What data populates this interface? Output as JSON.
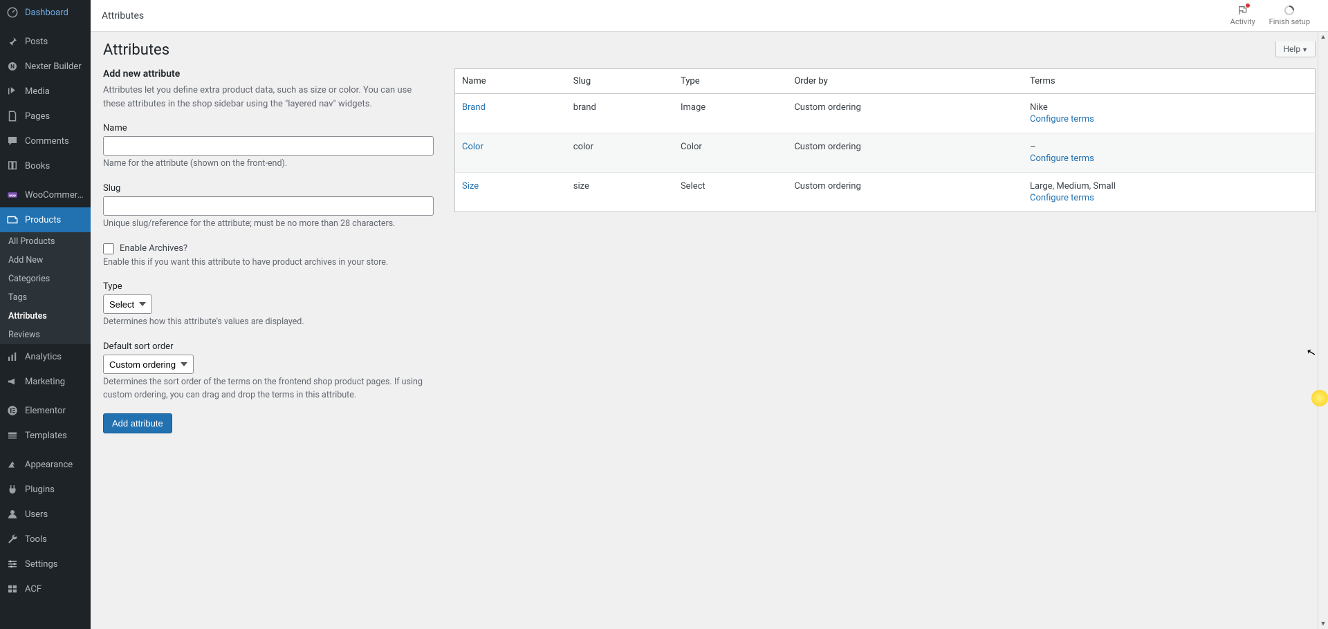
{
  "sidebar": {
    "items": [
      {
        "icon": "dashboard",
        "label": "Dashboard"
      },
      {
        "icon": "pin",
        "label": "Posts"
      },
      {
        "icon": "nexter",
        "label": "Nexter Builder"
      },
      {
        "icon": "media",
        "label": "Media"
      },
      {
        "icon": "page",
        "label": "Pages"
      },
      {
        "icon": "comments",
        "label": "Comments"
      },
      {
        "icon": "book",
        "label": "Books"
      },
      {
        "icon": "woo",
        "label": "WooCommerce"
      },
      {
        "icon": "products",
        "label": "Products",
        "current": true
      },
      {
        "icon": "analytics",
        "label": "Analytics"
      },
      {
        "icon": "marketing",
        "label": "Marketing"
      },
      {
        "icon": "elementor",
        "label": "Elementor"
      },
      {
        "icon": "templates",
        "label": "Templates"
      },
      {
        "icon": "appearance",
        "label": "Appearance"
      },
      {
        "icon": "plugins",
        "label": "Plugins"
      },
      {
        "icon": "users",
        "label": "Users"
      },
      {
        "icon": "tools",
        "label": "Tools"
      },
      {
        "icon": "settings",
        "label": "Settings"
      },
      {
        "icon": "acf",
        "label": "ACF"
      }
    ],
    "submenu": [
      {
        "label": "All Products"
      },
      {
        "label": "Add New"
      },
      {
        "label": "Categories"
      },
      {
        "label": "Tags"
      },
      {
        "label": "Attributes",
        "current": true
      },
      {
        "label": "Reviews"
      }
    ]
  },
  "topbar": {
    "breadcrumb": "Attributes",
    "activity": "Activity",
    "finish": "Finish setup"
  },
  "page": {
    "title": "Attributes",
    "help": "Help"
  },
  "form": {
    "heading": "Add new attribute",
    "intro": "Attributes let you define extra product data, such as size or color. You can use these attributes in the shop sidebar using the \"layered nav\" widgets.",
    "name_label": "Name",
    "name_hint": "Name for the attribute (shown on the front-end).",
    "slug_label": "Slug",
    "slug_hint": "Unique slug/reference for the attribute; must be no more than 28 characters.",
    "archives_label": "Enable Archives?",
    "archives_hint": "Enable this if you want this attribute to have product archives in your store.",
    "type_label": "Type",
    "type_value": "Select",
    "type_hint": "Determines how this attribute's values are displayed.",
    "sort_label": "Default sort order",
    "sort_value": "Custom ordering",
    "sort_hint": "Determines the sort order of the terms on the frontend shop product pages. If using custom ordering, you can drag and drop the terms in this attribute.",
    "submit": "Add attribute"
  },
  "table": {
    "headers": {
      "name": "Name",
      "slug": "Slug",
      "type": "Type",
      "order": "Order by",
      "terms": "Terms"
    },
    "configure": "Configure terms",
    "rows": [
      {
        "name": "Brand",
        "slug": "brand",
        "type": "Image",
        "order": "Custom ordering",
        "terms": "Nike"
      },
      {
        "name": "Color",
        "slug": "color",
        "type": "Color",
        "order": "Custom ordering",
        "terms": "–"
      },
      {
        "name": "Size",
        "slug": "size",
        "type": "Select",
        "order": "Custom ordering",
        "terms": "Large, Medium, Small"
      }
    ]
  }
}
